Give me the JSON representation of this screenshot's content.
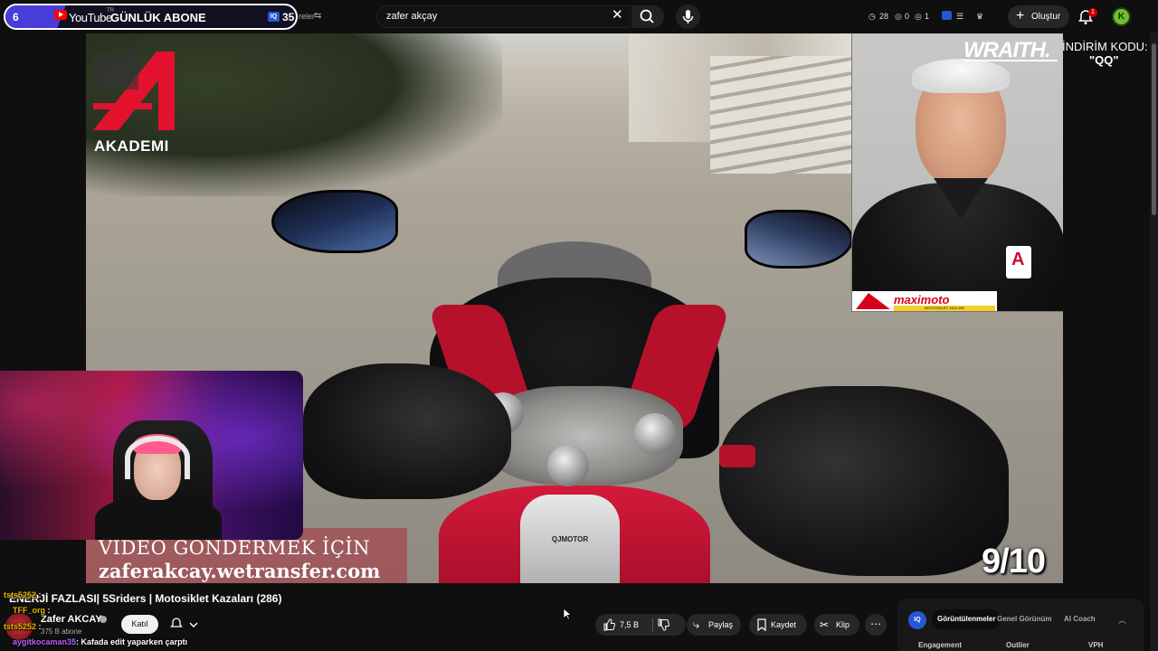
{
  "abone_widget": {
    "count": "6",
    "platform_logo": "YouTube",
    "platform_region": "TR",
    "title": "GÜNLÜK ABONE",
    "iq_badge": "IQ",
    "iq_count": "35",
    "filters_label": "reler"
  },
  "search": {
    "value": "zafer akçay",
    "clear_icon": "close-icon",
    "search_icon": "search-icon",
    "mic_icon": "microphone-icon"
  },
  "header": {
    "stats": [
      {
        "icon": "clock-icon",
        "value": "28"
      },
      {
        "icon": "eye-icon",
        "value": "0"
      },
      {
        "icon": "eye-icon",
        "value": "1"
      }
    ],
    "create_label": "Oluştur",
    "notifications_count": "1",
    "avatar_letter": "K"
  },
  "video_overlay": {
    "brand_text": "AKADEMI",
    "banner_line1": "VIDEO GONDERMEK İÇİN",
    "banner_line2": "zaferakcay.wetransfer.com",
    "score": "9/10",
    "engine_brand": "QJMOTOR",
    "sponsor_brand": "maximoto",
    "sponsor_sub": "MOTOSIKLET YAGLARI",
    "sponsor_wraith": "WRAITH.",
    "discount_line1": "İNDİRİM KODU:",
    "discount_line2": "\"QQ\""
  },
  "video_info": {
    "title": "ENERJİ FAZLASI| 5Sriders | Motosiklet Kazaları (286)",
    "channel_name": "Zafer AKCAY",
    "subscribers": "375 B abone",
    "join_label": "Katıl",
    "like_count": "7,5 B",
    "share_label": "Paylaş",
    "save_label": "Kaydet",
    "clip_label": "Klip"
  },
  "chat": [
    {
      "user": "tsts5252",
      "text": ":",
      "color": "#e6b800"
    },
    {
      "user": "TFF_org",
      "text": ":",
      "color": "#e6b800"
    },
    {
      "user": "tsts5252",
      "text": ":",
      "color": "#e6b800"
    },
    {
      "user": "aygitkocaman35",
      "text": ": Kafada edit yaparken çarptı",
      "color": "#c15cff"
    }
  ],
  "iq_panel": {
    "logo": "IQ",
    "tabs": [
      "Görüntülenmeler",
      "Genel Görünüm",
      "AI Coach"
    ],
    "columns": [
      "Engagement",
      "Outlier",
      "VPH"
    ]
  },
  "colors": {
    "accent_red": "#ff0000",
    "iq_blue": "#2557d6",
    "widget_purple": "#4a3cd6"
  }
}
